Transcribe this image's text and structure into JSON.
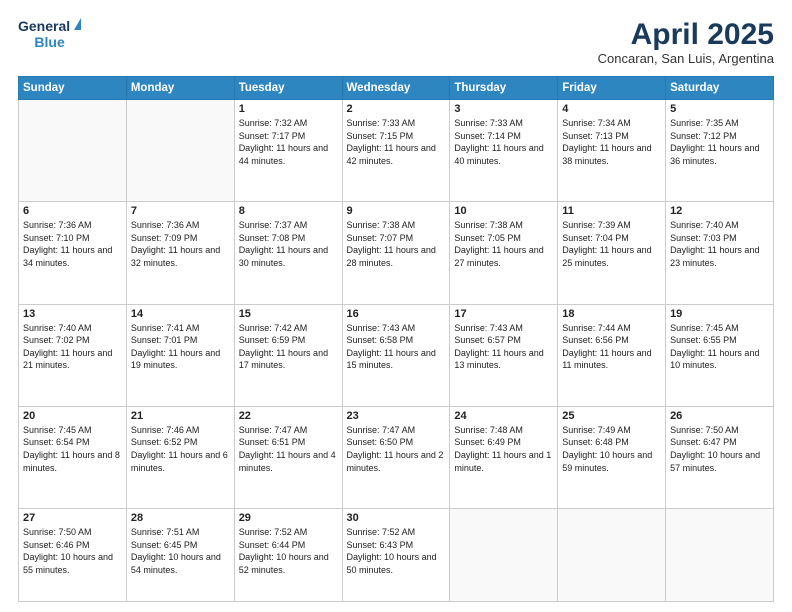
{
  "header": {
    "logo_line1": "General",
    "logo_line2": "Blue",
    "title": "April 2025",
    "subtitle": "Concaran, San Luis, Argentina"
  },
  "days_of_week": [
    "Sunday",
    "Monday",
    "Tuesday",
    "Wednesday",
    "Thursday",
    "Friday",
    "Saturday"
  ],
  "weeks": [
    [
      {
        "day": "",
        "text": ""
      },
      {
        "day": "",
        "text": ""
      },
      {
        "day": "1",
        "text": "Sunrise: 7:32 AM\nSunset: 7:17 PM\nDaylight: 11 hours and 44 minutes."
      },
      {
        "day": "2",
        "text": "Sunrise: 7:33 AM\nSunset: 7:15 PM\nDaylight: 11 hours and 42 minutes."
      },
      {
        "day": "3",
        "text": "Sunrise: 7:33 AM\nSunset: 7:14 PM\nDaylight: 11 hours and 40 minutes."
      },
      {
        "day": "4",
        "text": "Sunrise: 7:34 AM\nSunset: 7:13 PM\nDaylight: 11 hours and 38 minutes."
      },
      {
        "day": "5",
        "text": "Sunrise: 7:35 AM\nSunset: 7:12 PM\nDaylight: 11 hours and 36 minutes."
      }
    ],
    [
      {
        "day": "6",
        "text": "Sunrise: 7:36 AM\nSunset: 7:10 PM\nDaylight: 11 hours and 34 minutes."
      },
      {
        "day": "7",
        "text": "Sunrise: 7:36 AM\nSunset: 7:09 PM\nDaylight: 11 hours and 32 minutes."
      },
      {
        "day": "8",
        "text": "Sunrise: 7:37 AM\nSunset: 7:08 PM\nDaylight: 11 hours and 30 minutes."
      },
      {
        "day": "9",
        "text": "Sunrise: 7:38 AM\nSunset: 7:07 PM\nDaylight: 11 hours and 28 minutes."
      },
      {
        "day": "10",
        "text": "Sunrise: 7:38 AM\nSunset: 7:05 PM\nDaylight: 11 hours and 27 minutes."
      },
      {
        "day": "11",
        "text": "Sunrise: 7:39 AM\nSunset: 7:04 PM\nDaylight: 11 hours and 25 minutes."
      },
      {
        "day": "12",
        "text": "Sunrise: 7:40 AM\nSunset: 7:03 PM\nDaylight: 11 hours and 23 minutes."
      }
    ],
    [
      {
        "day": "13",
        "text": "Sunrise: 7:40 AM\nSunset: 7:02 PM\nDaylight: 11 hours and 21 minutes."
      },
      {
        "day": "14",
        "text": "Sunrise: 7:41 AM\nSunset: 7:01 PM\nDaylight: 11 hours and 19 minutes."
      },
      {
        "day": "15",
        "text": "Sunrise: 7:42 AM\nSunset: 6:59 PM\nDaylight: 11 hours and 17 minutes."
      },
      {
        "day": "16",
        "text": "Sunrise: 7:43 AM\nSunset: 6:58 PM\nDaylight: 11 hours and 15 minutes."
      },
      {
        "day": "17",
        "text": "Sunrise: 7:43 AM\nSunset: 6:57 PM\nDaylight: 11 hours and 13 minutes."
      },
      {
        "day": "18",
        "text": "Sunrise: 7:44 AM\nSunset: 6:56 PM\nDaylight: 11 hours and 11 minutes."
      },
      {
        "day": "19",
        "text": "Sunrise: 7:45 AM\nSunset: 6:55 PM\nDaylight: 11 hours and 10 minutes."
      }
    ],
    [
      {
        "day": "20",
        "text": "Sunrise: 7:45 AM\nSunset: 6:54 PM\nDaylight: 11 hours and 8 minutes."
      },
      {
        "day": "21",
        "text": "Sunrise: 7:46 AM\nSunset: 6:52 PM\nDaylight: 11 hours and 6 minutes."
      },
      {
        "day": "22",
        "text": "Sunrise: 7:47 AM\nSunset: 6:51 PM\nDaylight: 11 hours and 4 minutes."
      },
      {
        "day": "23",
        "text": "Sunrise: 7:47 AM\nSunset: 6:50 PM\nDaylight: 11 hours and 2 minutes."
      },
      {
        "day": "24",
        "text": "Sunrise: 7:48 AM\nSunset: 6:49 PM\nDaylight: 11 hours and 1 minute."
      },
      {
        "day": "25",
        "text": "Sunrise: 7:49 AM\nSunset: 6:48 PM\nDaylight: 10 hours and 59 minutes."
      },
      {
        "day": "26",
        "text": "Sunrise: 7:50 AM\nSunset: 6:47 PM\nDaylight: 10 hours and 57 minutes."
      }
    ],
    [
      {
        "day": "27",
        "text": "Sunrise: 7:50 AM\nSunset: 6:46 PM\nDaylight: 10 hours and 55 minutes."
      },
      {
        "day": "28",
        "text": "Sunrise: 7:51 AM\nSunset: 6:45 PM\nDaylight: 10 hours and 54 minutes."
      },
      {
        "day": "29",
        "text": "Sunrise: 7:52 AM\nSunset: 6:44 PM\nDaylight: 10 hours and 52 minutes."
      },
      {
        "day": "30",
        "text": "Sunrise: 7:52 AM\nSunset: 6:43 PM\nDaylight: 10 hours and 50 minutes."
      },
      {
        "day": "",
        "text": ""
      },
      {
        "day": "",
        "text": ""
      },
      {
        "day": "",
        "text": ""
      }
    ]
  ]
}
